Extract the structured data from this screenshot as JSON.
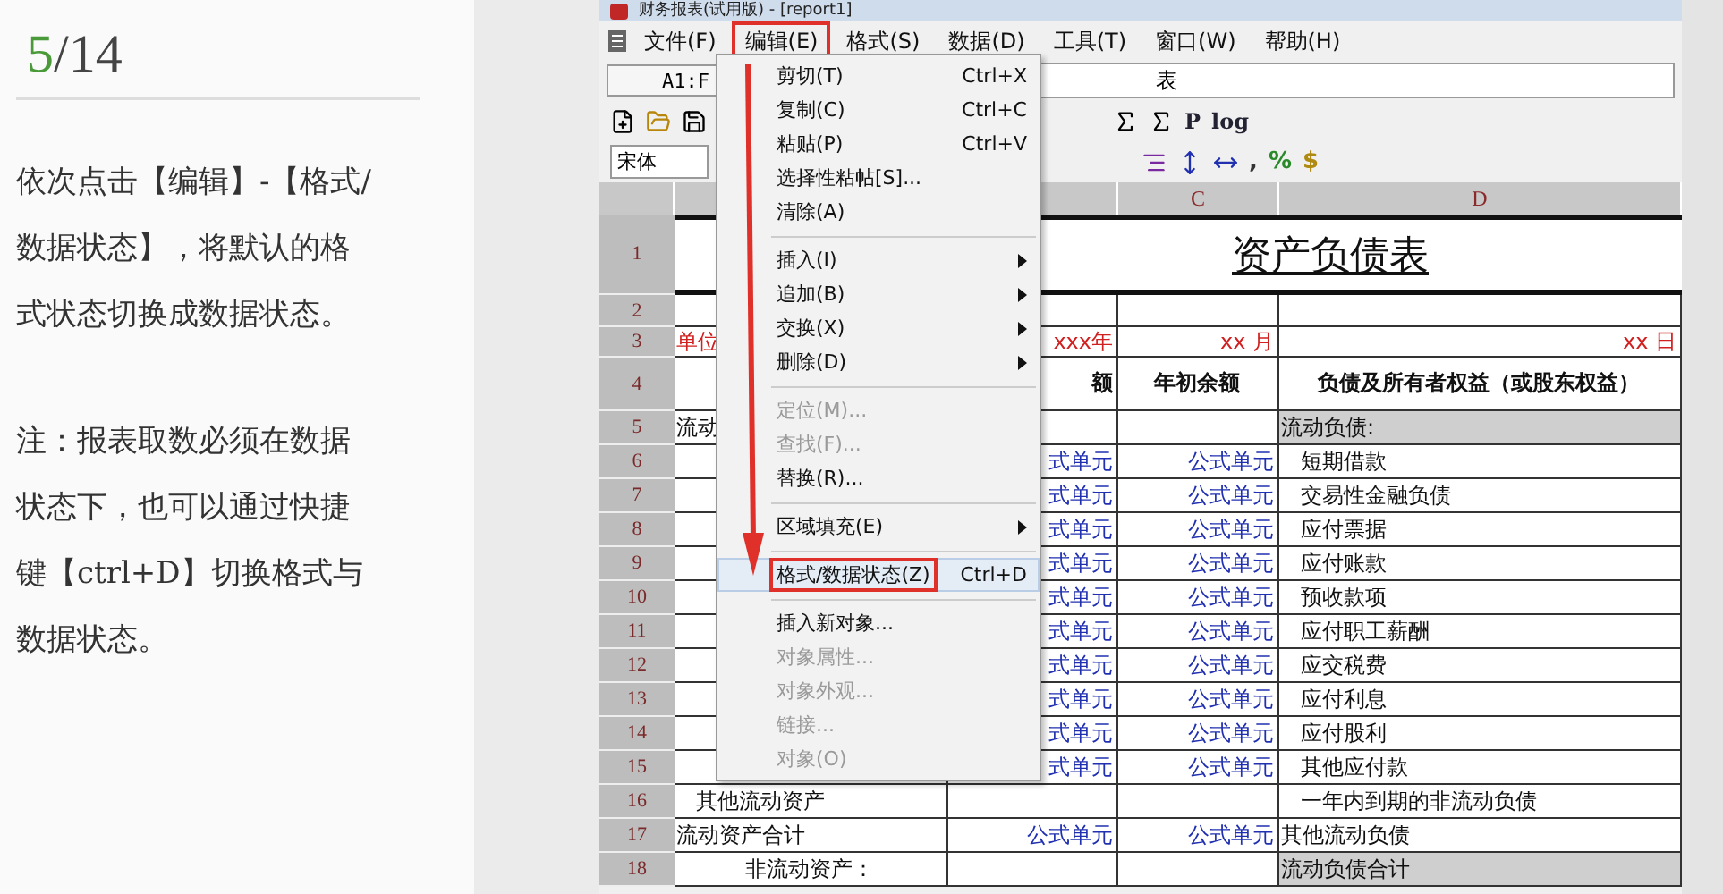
{
  "slide": {
    "current": "5",
    "rest": "/14",
    "paragraphs": [
      "依次点击【编辑】-【格式/数据状态】，将默认的格式状态切换成数据状态。",
      "注：报表取数必须在数据状态下，也可以通过快捷键【ctrl+D】切换格式与数据状态。"
    ]
  },
  "window": {
    "title": "财务报表(试用版) - [report1]"
  },
  "menu_bar": [
    {
      "label": "文件(F)",
      "selected": false
    },
    {
      "label": "编辑(E)",
      "selected": true
    },
    {
      "label": "格式(S)",
      "selected": false
    },
    {
      "label": "数据(D)",
      "selected": false
    },
    {
      "label": "工具(T)",
      "selected": false
    },
    {
      "label": "窗口(W)",
      "selected": false
    },
    {
      "label": "帮助(H)",
      "selected": false
    }
  ],
  "formula_bar": {
    "cell": "A1:F",
    "content": "表"
  },
  "toolbar": {
    "glyphs": [
      "P",
      "log"
    ],
    "font": "宋体",
    "symbols": [
      ",",
      "%",
      "$"
    ]
  },
  "columns": [
    "C",
    "D"
  ],
  "rows": [
    {
      "number": "1",
      "kind": "title",
      "title": "资产负债表"
    },
    {
      "number": "2",
      "kind": "normal",
      "cells": [
        {},
        {},
        {},
        {}
      ]
    },
    {
      "number": "3",
      "kind": "normal",
      "cells": [
        {
          "text": "单位",
          "kind": "unit"
        },
        {
          "text": "xxx年",
          "kind": "unit"
        },
        {
          "text": "xx  月",
          "kind": "unit"
        },
        {
          "text": "xx  日",
          "kind": "unit"
        }
      ]
    },
    {
      "number": "4",
      "kind": "normal",
      "cells": [
        {},
        {
          "text": "额",
          "kind": "heading"
        },
        {
          "text": "年初余额",
          "kind": "heading"
        },
        {
          "text": "负债及所有者权益（或股东权益）",
          "kind": "heading"
        }
      ]
    },
    {
      "number": "5",
      "kind": "normal",
      "cells": [
        {
          "text": "流动",
          "kind": "label"
        },
        {},
        {},
        {
          "text": "流动负债:",
          "kind": "label",
          "shaded": true
        }
      ]
    },
    {
      "number": "6",
      "kind": "normal",
      "cells": [
        {},
        {
          "text": "式单元",
          "kind": "formula"
        },
        {
          "text": "公式单元",
          "kind": "formula"
        },
        {
          "text": "短期借款",
          "kind": "item"
        }
      ]
    },
    {
      "number": "7",
      "kind": "normal",
      "cells": [
        {},
        {
          "text": "式单元",
          "kind": "formula"
        },
        {
          "text": "公式单元",
          "kind": "formula"
        },
        {
          "text": "交易性金融负债",
          "kind": "item"
        }
      ]
    },
    {
      "number": "8",
      "kind": "normal",
      "cells": [
        {},
        {
          "text": "式单元",
          "kind": "formula"
        },
        {
          "text": "公式单元",
          "kind": "formula"
        },
        {
          "text": "应付票据",
          "kind": "item"
        }
      ]
    },
    {
      "number": "9",
      "kind": "normal",
      "cells": [
        {},
        {
          "text": "式单元",
          "kind": "formula"
        },
        {
          "text": "公式单元",
          "kind": "formula"
        },
        {
          "text": "应付账款",
          "kind": "item"
        }
      ]
    },
    {
      "number": "10",
      "kind": "normal",
      "cells": [
        {},
        {
          "text": "式单元",
          "kind": "formula"
        },
        {
          "text": "公式单元",
          "kind": "formula"
        },
        {
          "text": "预收款项",
          "kind": "item"
        }
      ]
    },
    {
      "number": "11",
      "kind": "normal",
      "cells": [
        {},
        {
          "text": "式单元",
          "kind": "formula"
        },
        {
          "text": "公式单元",
          "kind": "formula"
        },
        {
          "text": "应付职工薪酬",
          "kind": "item"
        }
      ]
    },
    {
      "number": "12",
      "kind": "normal",
      "cells": [
        {},
        {
          "text": "式单元",
          "kind": "formula"
        },
        {
          "text": "公式单元",
          "kind": "formula"
        },
        {
          "text": "应交税费",
          "kind": "item"
        }
      ]
    },
    {
      "number": "13",
      "kind": "normal",
      "cells": [
        {},
        {
          "text": "式单元",
          "kind": "formula"
        },
        {
          "text": "公式单元",
          "kind": "formula"
        },
        {
          "text": "应付利息",
          "kind": "item"
        }
      ]
    },
    {
      "number": "14",
      "kind": "normal",
      "cells": [
        {},
        {
          "text": "式单元",
          "kind": "formula"
        },
        {
          "text": "公式单元",
          "kind": "formula"
        },
        {
          "text": "应付股利",
          "kind": "item"
        }
      ]
    },
    {
      "number": "15",
      "kind": "normal",
      "cells": [
        {},
        {
          "text": "式单元",
          "kind": "formula"
        },
        {
          "text": "公式单元",
          "kind": "formula"
        },
        {
          "text": "其他应付款",
          "kind": "item"
        }
      ]
    },
    {
      "number": "16",
      "kind": "normal",
      "cells": [
        {
          "text": "其他流动资产",
          "kind": "item"
        },
        {},
        {},
        {
          "text": "一年内到期的非流动负债",
          "kind": "item"
        }
      ]
    },
    {
      "number": "17",
      "kind": "normal",
      "cells": [
        {
          "text": "流动资产合计",
          "kind": "label"
        },
        {
          "text": "公式单元",
          "kind": "formula"
        },
        {
          "text": "公式单元",
          "kind": "formula"
        },
        {
          "text": "其他流动负债",
          "kind": "label"
        }
      ]
    },
    {
      "number": "18",
      "kind": "normal",
      "cells": [
        {
          "text": "非流动资产：",
          "kind": "center"
        },
        {},
        {},
        {
          "text": "流动负债合计",
          "kind": "label",
          "shaded": true
        }
      ]
    }
  ],
  "edit_menu": [
    {
      "kind": "item",
      "label": "剪切(T)",
      "shortcut": "Ctrl+X",
      "disabled": false,
      "submenu": false,
      "selected": false
    },
    {
      "kind": "item",
      "label": "复制(C)",
      "shortcut": "Ctrl+C",
      "disabled": false,
      "submenu": false,
      "selected": false
    },
    {
      "kind": "item",
      "label": "粘贴(P)",
      "shortcut": "Ctrl+V",
      "disabled": false,
      "submenu": false,
      "selected": false
    },
    {
      "kind": "item",
      "label": "选择性粘帖[S]...",
      "disabled": false,
      "submenu": false,
      "selected": false
    },
    {
      "kind": "item",
      "label": "清除(A)",
      "disabled": false,
      "submenu": false,
      "selected": false
    },
    {
      "kind": "separator"
    },
    {
      "kind": "item",
      "label": "插入(I)",
      "disabled": false,
      "submenu": true,
      "selected": false
    },
    {
      "kind": "item",
      "label": "追加(B)",
      "disabled": false,
      "submenu": true,
      "selected": false
    },
    {
      "kind": "item",
      "label": "交换(X)",
      "disabled": false,
      "submenu": true,
      "selected": false
    },
    {
      "kind": "item",
      "label": "删除(D)",
      "disabled": false,
      "submenu": true,
      "selected": false
    },
    {
      "kind": "separator"
    },
    {
      "kind": "item",
      "label": "定位(M)...",
      "disabled": true,
      "submenu": false,
      "selected": false
    },
    {
      "kind": "item",
      "label": "查找(F)...",
      "disabled": true,
      "submenu": false,
      "selected": false
    },
    {
      "kind": "item",
      "label": "替换(R)...",
      "disabled": false,
      "submenu": false,
      "selected": false
    },
    {
      "kind": "separator"
    },
    {
      "kind": "item",
      "label": "区域填充(E)",
      "disabled": false,
      "submenu": true,
      "selected": false
    },
    {
      "kind": "separator"
    },
    {
      "kind": "item",
      "label": "格式/数据状态(Z)",
      "shortcut": "Ctrl+D",
      "disabled": false,
      "submenu": false,
      "selected": true
    },
    {
      "kind": "separator"
    },
    {
      "kind": "item",
      "label": "插入新对象...",
      "disabled": false,
      "submenu": false,
      "selected": false
    },
    {
      "kind": "item",
      "label": "对象属性...",
      "disabled": true,
      "submenu": false,
      "selected": false
    },
    {
      "kind": "item",
      "label": "对象外观...",
      "disabled": true,
      "submenu": false,
      "selected": false
    },
    {
      "kind": "item",
      "label": "链接...",
      "disabled": true,
      "submenu": false,
      "selected": false
    },
    {
      "kind": "item",
      "label": "对象(O)",
      "disabled": true,
      "submenu": false,
      "selected": false
    }
  ]
}
